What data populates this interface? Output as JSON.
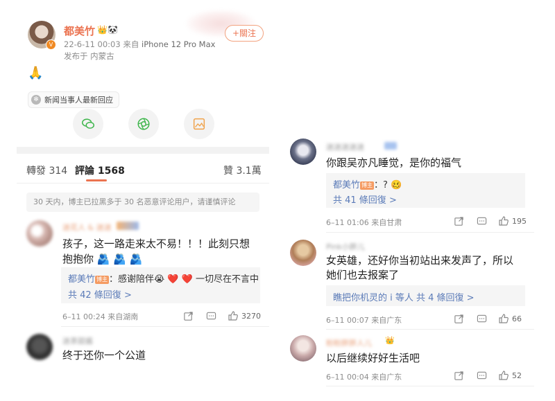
{
  "post": {
    "author": "都美竹",
    "time_meta": "22-6-11 00:03  来自",
    "device": "iPhone 12 Pro Max",
    "location": "发布于 内蒙古",
    "follow_label": "+關注",
    "content_emoji": "🙏",
    "topic_label": "新闻当事人最新回应"
  },
  "stats": {
    "repost_label": "轉發",
    "repost_count": "314",
    "comment_label": "評論",
    "comment_count": "1568",
    "like_label": "贊",
    "like_count": "3.1萬"
  },
  "notice": "30 天内，博主已拉黑多于 30 名恶意评论用户，请谨慎评论",
  "comments_left": [
    {
      "name": "迷花人 & 迷迷",
      "text_line1": "孩子，这一路走来太不易！！！此刻只想",
      "text_line2": "抱抱你 🫂 🫂 🫂",
      "reply_author": "都美竹",
      "reply_tag": "博主",
      "reply_text": "：感谢陪伴😭 ❤️ ❤️ 一切尽在不言中",
      "reply_more": "共 42 條回復 >",
      "meta": "6–11 00:24  来自湖南",
      "likes": "3270"
    },
    {
      "name": "迷茶甜酱",
      "text_line1": "终于还你一个公道"
    }
  ],
  "comments_right": [
    {
      "name": "迷迷迷迷迷",
      "text_line1": "你跟吴亦凡睡觉，是你的福气",
      "reply_author": "都美竹",
      "reply_tag": "博主",
      "reply_text": "：? 🥴",
      "reply_more": "共 41 條回復 >",
      "meta": "6–11 01:06  来自甘肃",
      "likes": "195"
    },
    {
      "name": "Pink小胖儿",
      "text_line1": "女英雄，还好你当初站出来发声了，所以",
      "text_line2": "她们也去报案了",
      "reply_text": "瞧把你机灵的 i 等人 共 4 條回復 >",
      "meta": "6–11 00:07  来自广东",
      "likes": "66"
    },
    {
      "name": "粉粉胖胖人儿",
      "text_line1": "以后继续好好生活吧",
      "meta": "6–11 00:04  来自广东",
      "likes": "52"
    }
  ],
  "colors": {
    "accent": "#eb7350",
    "link": "#5b7bb8",
    "gray": "#8c8c8c",
    "bg_gray": "#f5f5f5"
  }
}
